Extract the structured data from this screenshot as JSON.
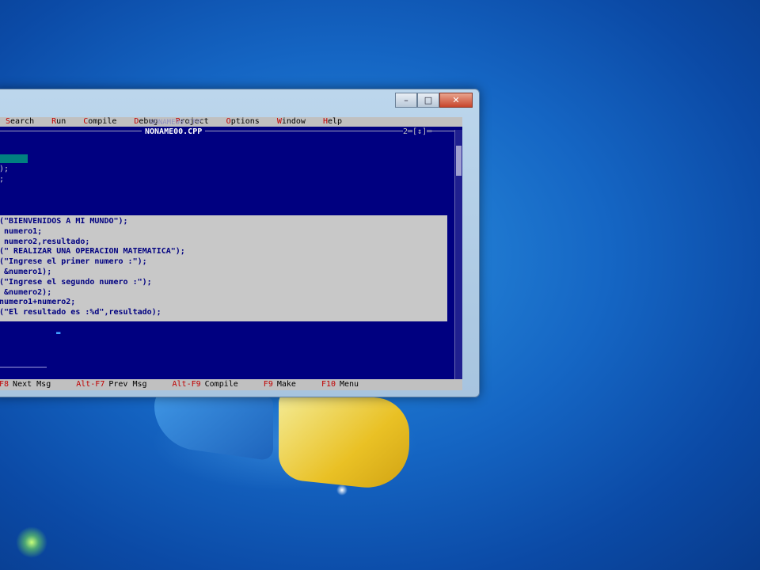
{
  "desktop": {
    "colors": {
      "background": "#1566c4",
      "flag_blue": "#4aa3ee",
      "flag_yellow": "#f4c51c"
    }
  },
  "window": {
    "buttons": {
      "minimize": "–",
      "maximize": "□",
      "close": "✕"
    }
  },
  "menu": [
    "Search",
    "Run",
    "Compile",
    "Debug",
    "Project",
    "Options",
    "Window",
    "Help"
  ],
  "editor": {
    "filename_back": "NONAME00.CPP",
    "filename": "NONAME00.CPP",
    "window_number": "2═[↕]═",
    "top_lines": [
      "",
      "",
      ");",
      ";",
      ""
    ],
    "code_lines": [
      "(\"BIENVENIDOS A MI MUNDO\");",
      " numero1;",
      " numero2,resultado;",
      "(\" REALIZAR UNA OPERACION MATEMATICA\");",
      "(\"Ingrese el primer numero :\");",
      " &numero1);",
      "(\"Ingrese el segundo numero :\");",
      " &numero2);",
      "numero1+numero2;",
      "(\"El resultado es :%d\",resultado);"
    ]
  },
  "statusbar": [
    {
      "key": "F8",
      "label": "Next Msg"
    },
    {
      "key": "Alt-F7",
      "label": "Prev Msg"
    },
    {
      "key": "Alt-F9",
      "label": "Compile"
    },
    {
      "key": "F9",
      "label": "Make"
    },
    {
      "key": "F10",
      "label": "Menu"
    }
  ]
}
